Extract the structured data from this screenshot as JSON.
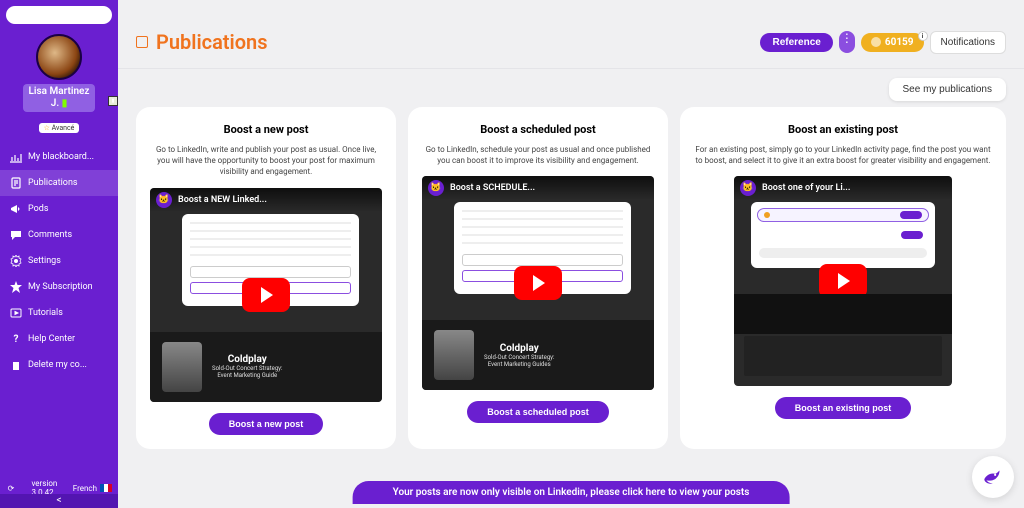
{
  "sidebar": {
    "user_name_line1": "Lisa  Martinez",
    "user_name_line2": "J.",
    "badge": "Avancé",
    "nav": [
      {
        "label": "My blackboard...",
        "icon": "chart"
      },
      {
        "label": "Publications",
        "icon": "doc"
      },
      {
        "label": "Pods",
        "icon": "mega"
      },
      {
        "label": "Comments",
        "icon": "chat"
      },
      {
        "label": "Settings",
        "icon": "gear"
      },
      {
        "label": "My Subscription",
        "icon": "star"
      },
      {
        "label": "Tutorials",
        "icon": "play"
      },
      {
        "label": "Help Center",
        "icon": "help"
      },
      {
        "label": "Delete my co...",
        "icon": "trash"
      }
    ],
    "version_label": "version",
    "version": "3.0.42",
    "language": "French",
    "collapse": "<"
  },
  "header": {
    "title": "Publications",
    "reference": "Reference",
    "points": "60159",
    "notifications": "Notifications",
    "info_dot": "i"
  },
  "actions": {
    "see_pubs": "See my publications"
  },
  "cards": [
    {
      "title": "Boost a new post",
      "desc": "Go to LinkedIn, write and publish your post as usual. Once live, you will have the opportunity to boost your post for maximum visibility and engagement.",
      "video_label": "Boost a NEW Linked...",
      "featured_band": "Coldplay",
      "featured_sub1": "Sold-Out Concert Strategy:",
      "featured_sub2": "Event Marketing Guide",
      "cta": "Boost a new post"
    },
    {
      "title": "Boost a scheduled post",
      "desc": "Go to LinkedIn, schedule your post as usual and once published you can boost it to improve its visibility and engagement.",
      "video_label": "Boost a SCHEDULE...",
      "featured_band": "Coldplay",
      "featured_sub1": "Sold-Out Concert Strategy:",
      "featured_sub2": "Event Marketing Guides",
      "cta": "Boost a scheduled post"
    },
    {
      "title": "Boost an existing post",
      "desc": "For an existing post, simply go to your LinkedIn activity page, find the post you want to boost, and select it to give it an extra boost for greater visibility and engagement.",
      "video_label": "Boost one of your Li...",
      "cta": "Boost an existing post"
    }
  ],
  "banner": "Your posts are now only visible on Linkedin, please click here to view your posts"
}
